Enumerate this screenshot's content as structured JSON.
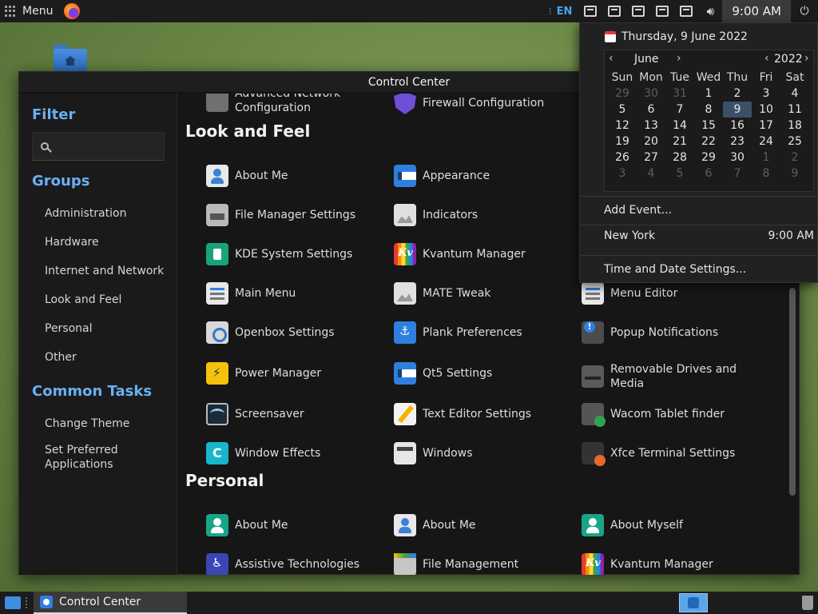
{
  "top_panel": {
    "menu_label": "Menu",
    "keyboard_layout": "EN",
    "clock": "9:00 AM"
  },
  "window": {
    "title": "Control Center"
  },
  "sidebar": {
    "filter_heading": "Filter",
    "search_placeholder": "",
    "groups_heading": "Groups",
    "groups": [
      "Administration",
      "Hardware",
      "Internet and Network",
      "Look and Feel",
      "Personal",
      "Other"
    ],
    "tasks_heading": "Common Tasks",
    "tasks": [
      "Change Theme",
      "Set Preferred Applications"
    ]
  },
  "content": {
    "top_items": [
      "Advanced Network Configuration",
      "Firewall Configuration"
    ],
    "look_and_feel": {
      "title": "Look and Feel",
      "items": [
        "About Me",
        "Appearance",
        "File Manager Settings",
        "Indicators",
        "KDE System Settings",
        "Kvantum Manager",
        "Main Menu",
        "MATE Tweak",
        "Menu Editor",
        "Openbox Settings",
        "Plank Preferences",
        "Popup Notifications",
        "Power Manager",
        "Qt5 Settings",
        "Removable Drives and Media",
        "Screensaver",
        "Text Editor Settings",
        "Wacom Tablet finder",
        "Window Effects",
        "Windows",
        "Xfce Terminal Settings"
      ]
    },
    "personal": {
      "title": "Personal",
      "items": [
        "About Me",
        "About Me",
        "About Myself",
        "Assistive Technologies",
        "File Management",
        "Kvantum Manager"
      ]
    }
  },
  "calendar": {
    "full_date": "Thursday,  9 June 2022",
    "month": "June",
    "year": "2022",
    "weekdays": [
      "Sun",
      "Mon",
      "Tue",
      "Wed",
      "Thu",
      "Fri",
      "Sat"
    ],
    "days": [
      [
        "29",
        "30",
        "31",
        "1",
        "2",
        "3",
        "4"
      ],
      [
        "5",
        "6",
        "7",
        "8",
        "9",
        "10",
        "11"
      ],
      [
        "12",
        "13",
        "14",
        "15",
        "16",
        "17",
        "18"
      ],
      [
        "19",
        "20",
        "21",
        "22",
        "23",
        "24",
        "25"
      ],
      [
        "26",
        "27",
        "28",
        "29",
        "30",
        "1",
        "2"
      ],
      [
        "3",
        "4",
        "5",
        "6",
        "7",
        "8",
        "9"
      ]
    ],
    "add_event": "Add Event...",
    "location": "New York",
    "location_time": "9:00 AM",
    "settings_link": "Time and Date Settings..."
  },
  "taskbar": {
    "task_label": "Control Center"
  }
}
